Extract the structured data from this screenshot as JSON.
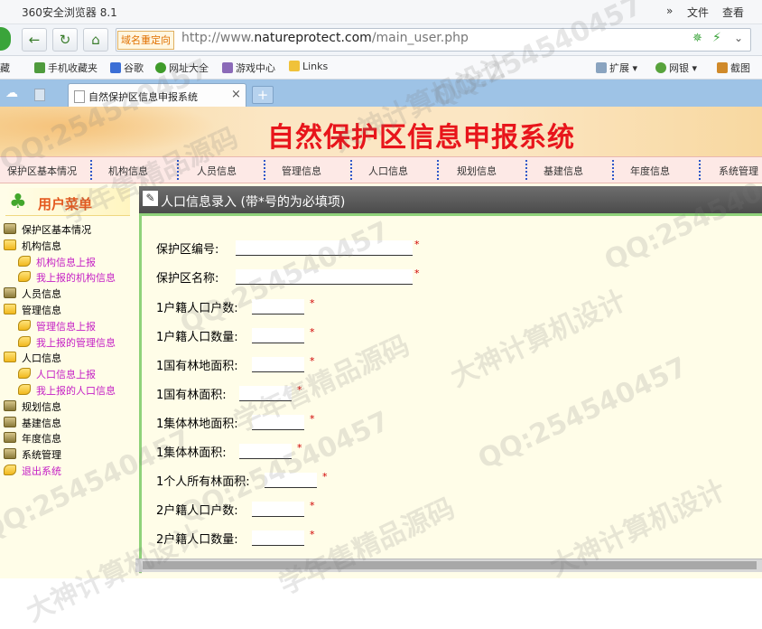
{
  "browser": {
    "app_title": "360安全浏览器 8.1",
    "menu_items": [
      "»",
      "文件",
      "查看"
    ],
    "redirect_label": "域名重定向",
    "url_prefix": "http://www.",
    "url_domain": "natureprotect.com",
    "url_path": "/main_user.php",
    "bookmarks": [
      "藏",
      "手机收藏夹",
      "谷歌",
      "网址大全",
      "游戏中心",
      "Links",
      "扩展",
      "网银",
      "截图"
    ],
    "tab_title": "自然保护区信息申报系统",
    "tab_close": "×",
    "new_tab": "+"
  },
  "site": {
    "banner_title": "自然保护区信息申报系统",
    "top_menu": [
      "保护区基本情况",
      "机构信息",
      "人员信息",
      "管理信息",
      "人口信息",
      "规划信息",
      "基建信息",
      "年度信息",
      "系统管理"
    ]
  },
  "sidebar": {
    "title": "用户菜单",
    "items": [
      {
        "label": "保护区基本情况",
        "kind": "book",
        "indent": 0
      },
      {
        "label": "机构信息",
        "kind": "folder",
        "indent": 0
      },
      {
        "label": "机构信息上报",
        "kind": "leaf",
        "indent": 1
      },
      {
        "label": "我上报的机构信息",
        "kind": "leaf",
        "indent": 1
      },
      {
        "label": "人员信息",
        "kind": "book",
        "indent": 0
      },
      {
        "label": "管理信息",
        "kind": "folder",
        "indent": 0
      },
      {
        "label": "管理信息上报",
        "kind": "leaf",
        "indent": 1
      },
      {
        "label": "我上报的管理信息",
        "kind": "leaf",
        "indent": 1
      },
      {
        "label": "人口信息",
        "kind": "folder",
        "indent": 0
      },
      {
        "label": "人口信息上报",
        "kind": "leaf",
        "indent": 1
      },
      {
        "label": "我上报的人口信息",
        "kind": "leaf",
        "indent": 1
      },
      {
        "label": "规划信息",
        "kind": "book",
        "indent": 0
      },
      {
        "label": "基建信息",
        "kind": "book",
        "indent": 0
      },
      {
        "label": "年度信息",
        "kind": "book",
        "indent": 0
      },
      {
        "label": "系统管理",
        "kind": "book",
        "indent": 0
      },
      {
        "label": "退出系统",
        "kind": "leaf",
        "indent": 0
      }
    ]
  },
  "form": {
    "header": "人口信息录入 (带*号的为必填项)",
    "required_mark": "*",
    "fields": [
      {
        "label": "保护区编号:",
        "value": ""
      },
      {
        "label": "保护区名称:",
        "value": ""
      },
      {
        "label": "1户籍人口户数:",
        "value": ""
      },
      {
        "label": "1户籍人口数量:",
        "value": ""
      },
      {
        "label": "1国有林地面积:",
        "value": ""
      },
      {
        "label": "1国有林面积:",
        "value": ""
      },
      {
        "label": "1集体林地面积:",
        "value": ""
      },
      {
        "label": "1集体林面积:",
        "value": ""
      },
      {
        "label": "1个人所有林面积:",
        "value": ""
      },
      {
        "label": "2户籍人口户数:",
        "value": ""
      },
      {
        "label": "2户籍人口数量:",
        "value": ""
      }
    ]
  },
  "watermarks": [
    "QQ:254540457",
    "大神计算机设计",
    "学年售精品源码"
  ],
  "colors": {
    "banner_text": "#e8151b",
    "sidebar_link": "#c520c5",
    "required": "#d10000",
    "tab_strip": "#9ec3e6"
  }
}
